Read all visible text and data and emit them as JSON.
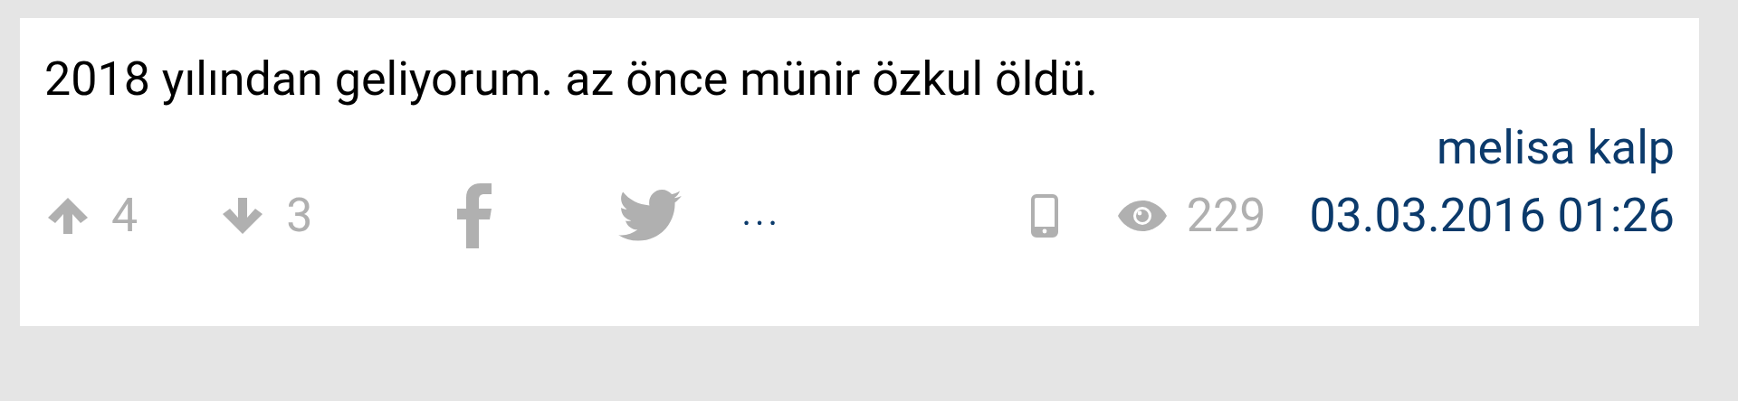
{
  "entry": {
    "text": "2018 yılından geliyorum. az önce münir özkul öldü.",
    "author": "melisa kalp",
    "upvotes": "4",
    "downvotes": "3",
    "more": "...",
    "views": "229",
    "posted_from_mobile": true,
    "date": "03.03.2016 01:26"
  }
}
